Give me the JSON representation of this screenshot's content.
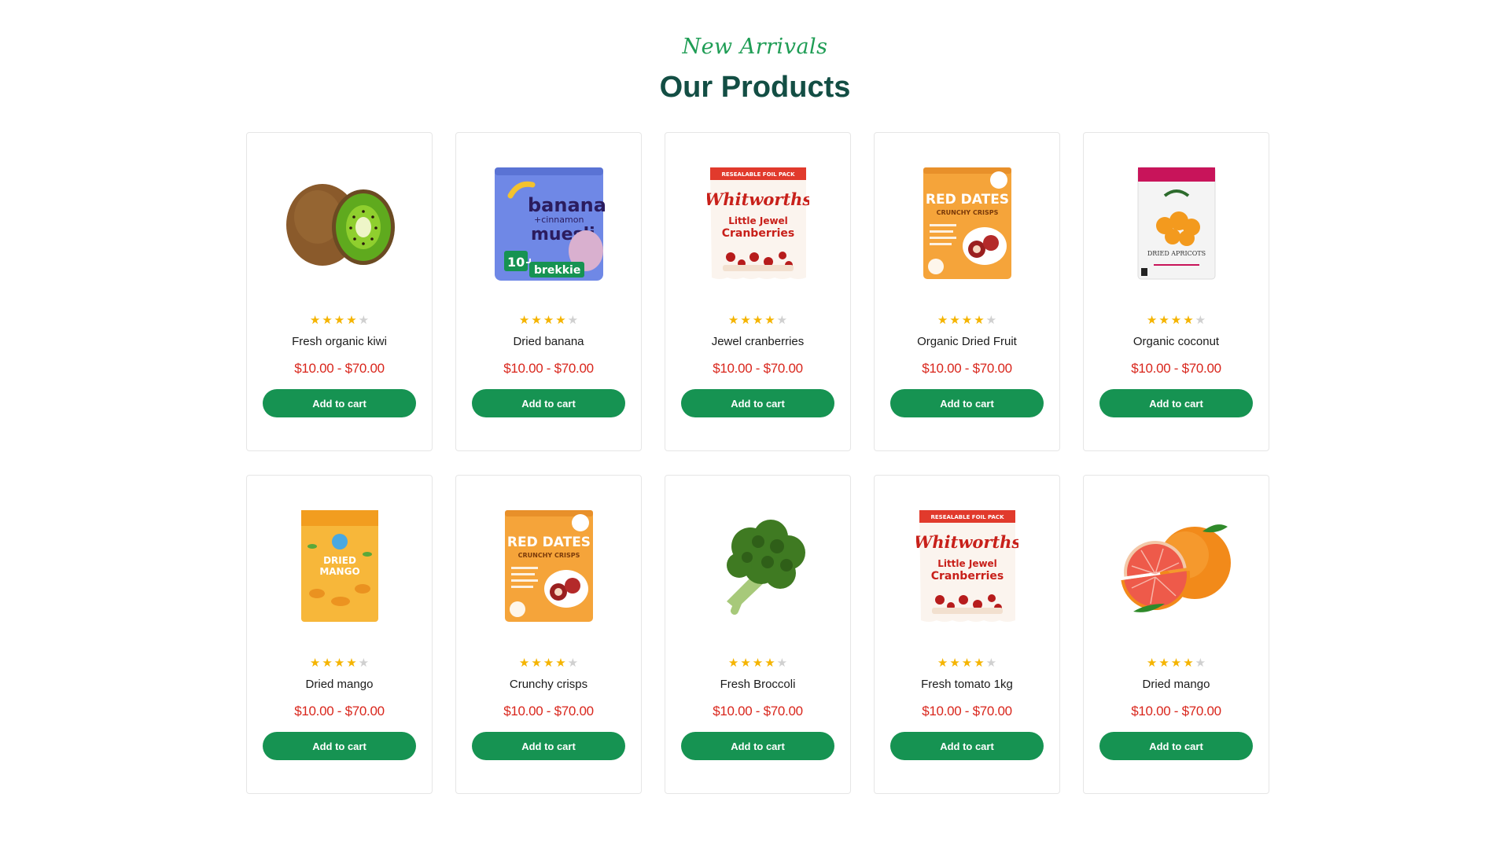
{
  "header": {
    "subtitle": "New Arrivals",
    "title": "Our Products"
  },
  "products": [
    {
      "name": "Fresh organic kiwi",
      "price": "$10.00 - $70.00",
      "rating": 4,
      "button": "Add to cart",
      "image": "kiwi"
    },
    {
      "name": "Dried banana",
      "price": "$10.00 - $70.00",
      "rating": 4,
      "button": "Add to cart",
      "image": "banana-pouch",
      "image_text": [
        "banana",
        "+cinnamon",
        "muesli",
        "10+",
        "brekkie"
      ]
    },
    {
      "name": "Jewel cranberries",
      "price": "$10.00 - $70.00",
      "rating": 4,
      "button": "Add to cart",
      "image": "cranberry-pouch",
      "image_text": [
        "RESEALABLE FOIL PACK",
        "Whitworths",
        "Little Jewel",
        "Cranberries"
      ]
    },
    {
      "name": "Organic Dried Fruit",
      "price": "$10.00 - $70.00",
      "rating": 4,
      "button": "Add to cart",
      "image": "dates-pouch",
      "image_text": [
        "RED DATES",
        "CRUNCHY CRISPS"
      ]
    },
    {
      "name": "Organic coconut",
      "price": "$10.00 - $70.00",
      "rating": 4,
      "button": "Add to cart",
      "image": "apricot-pouch",
      "image_text": [
        "DRIED APRICOTS"
      ]
    },
    {
      "name": "Dried mango",
      "price": "$10.00 - $70.00",
      "rating": 4,
      "button": "Add to cart",
      "image": "mango-pouch",
      "image_text": [
        "DRIED",
        "MANGO"
      ]
    },
    {
      "name": "Crunchy crisps",
      "price": "$10.00 - $70.00",
      "rating": 4,
      "button": "Add to cart",
      "image": "dates-pouch",
      "image_text": [
        "RED DATES",
        "CRUNCHY CRISPS"
      ]
    },
    {
      "name": "Fresh Broccoli",
      "price": "$10.00 - $70.00",
      "rating": 4,
      "button": "Add to cart",
      "image": "broccoli"
    },
    {
      "name": "Fresh tomato 1kg",
      "price": "$10.00 - $70.00",
      "rating": 4,
      "button": "Add to cart",
      "image": "cranberry-pouch",
      "image_text": [
        "RESEALABLE FOIL PACK",
        "Whitworths",
        "Little Jewel",
        "Cranberries"
      ]
    },
    {
      "name": "Dried mango",
      "price": "$10.00 - $70.00",
      "rating": 4,
      "button": "Add to cart",
      "image": "grapefruit"
    }
  ],
  "rating_max": 5,
  "colors": {
    "accent": "#169352",
    "title": "#134e44",
    "subtitle": "#1f9d55",
    "price": "#d9261c",
    "star": "#f5b400",
    "star_empty": "#d0d0d0"
  }
}
